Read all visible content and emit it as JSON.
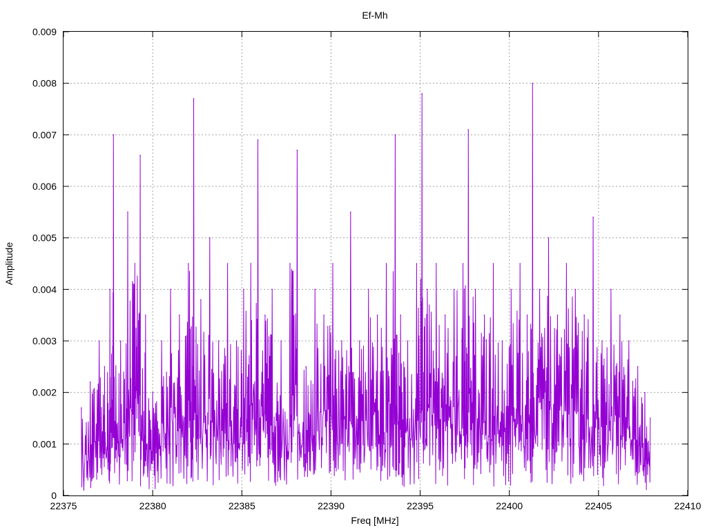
{
  "chart_data": {
    "type": "line",
    "title": "Ef-Mh",
    "xlabel": "Freq [MHz]",
    "ylabel": "Amplitude",
    "xlim": [
      22375,
      22410
    ],
    "ylim": [
      0,
      0.009
    ],
    "xticks": [
      "22375",
      "22380",
      "22385",
      "22390",
      "22395",
      "22400",
      "22405",
      "22410"
    ],
    "yticks": [
      "0",
      "0.001",
      "0.002",
      "0.003",
      "0.004",
      "0.005",
      "0.006",
      "0.007",
      "0.008",
      "0.009"
    ],
    "grid": true,
    "series_color": "#9400d3",
    "series": [
      {
        "x": [
          22376.0,
          22376.5,
          22377.0,
          22377.3,
          22377.6,
          22377.8,
          22378.2,
          22378.6,
          22379.0,
          22379.3,
          22379.6,
          22380.0,
          22380.5,
          22381.0,
          22381.5,
          22382.0,
          22382.3,
          22382.7,
          22383.2,
          22383.7,
          22384.2,
          22384.7,
          22385.1,
          22385.5,
          22385.9,
          22386.3,
          22386.7,
          22387.2,
          22387.7,
          22388.1,
          22388.6,
          22389.1,
          22389.6,
          22390.1,
          22390.6,
          22391.1,
          22391.6,
          22392.1,
          22392.6,
          22393.1,
          22393.6,
          22393.9,
          22394.3,
          22394.8,
          22395.1,
          22395.4,
          22395.9,
          22396.4,
          22396.9,
          22397.4,
          22397.7,
          22398.1,
          22398.6,
          22399.1,
          22399.6,
          22400.1,
          22400.6,
          22401.0,
          22401.3,
          22401.7,
          22402.2,
          22402.7,
          22403.2,
          22403.7,
          22404.2,
          22404.7,
          22405.2,
          22405.7,
          22406.2,
          22406.7,
          22407.2,
          22407.6,
          22407.9
        ],
        "y": [
          0.0017,
          0.0022,
          0.003,
          0.0025,
          0.004,
          0.007,
          0.003,
          0.0055,
          0.0045,
          0.0066,
          0.0035,
          0.002,
          0.003,
          0.004,
          0.0035,
          0.0045,
          0.0077,
          0.0038,
          0.005,
          0.003,
          0.0045,
          0.003,
          0.004,
          0.0045,
          0.0069,
          0.0035,
          0.004,
          0.003,
          0.0045,
          0.0067,
          0.0025,
          0.004,
          0.0035,
          0.0045,
          0.003,
          0.0055,
          0.003,
          0.004,
          0.0035,
          0.0045,
          0.007,
          0.0035,
          0.003,
          0.0045,
          0.0078,
          0.004,
          0.0045,
          0.0035,
          0.004,
          0.0045,
          0.0071,
          0.004,
          0.0035,
          0.0045,
          0.003,
          0.004,
          0.0045,
          0.0035,
          0.008,
          0.004,
          0.005,
          0.0035,
          0.0045,
          0.004,
          0.0035,
          0.0054,
          0.003,
          0.004,
          0.0035,
          0.003,
          0.0025,
          0.002,
          0.0015
        ]
      }
    ]
  }
}
